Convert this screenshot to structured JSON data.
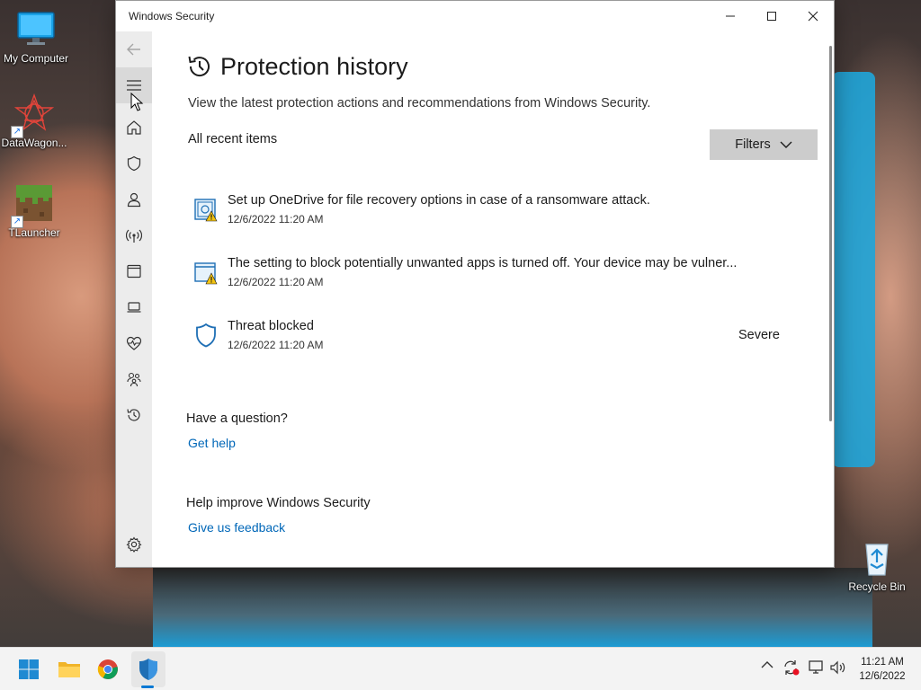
{
  "desktop": {
    "icons": [
      {
        "label": "My Computer"
      },
      {
        "label": "DataWagon..."
      },
      {
        "label": "TLauncher"
      },
      {
        "label": "Recycle Bin"
      }
    ]
  },
  "window": {
    "title": "Windows Security",
    "controls": {
      "minimize": "—",
      "maximize": "☐",
      "close": "✕"
    }
  },
  "sidebar": {
    "items": [
      {
        "name": "back-arrow-icon"
      },
      {
        "name": "hamburger-menu-icon"
      },
      {
        "name": "home-icon"
      },
      {
        "name": "shield-icon"
      },
      {
        "name": "person-icon"
      },
      {
        "name": "network-icon"
      },
      {
        "name": "app-browser-icon"
      },
      {
        "name": "device-laptop-icon"
      },
      {
        "name": "health-heart-icon"
      },
      {
        "name": "family-icon"
      },
      {
        "name": "history-icon"
      },
      {
        "name": "settings-gear-icon"
      }
    ]
  },
  "page": {
    "title": "Protection history",
    "subtitle": "View the latest protection actions and recommendations from Windows Security.",
    "section_label": "All recent items",
    "filters_label": "Filters"
  },
  "history": [
    {
      "message": "Set up OneDrive for file recovery options in case of a ransomware attack.",
      "date": "12/6/2022 11:20 AM",
      "severity": "",
      "icon": "folder-shield-warning-icon"
    },
    {
      "message": "The setting to block potentially unwanted apps is turned off. Your device may be vulner...",
      "date": "12/6/2022 11:20 AM",
      "severity": "",
      "icon": "app-browser-warning-icon"
    },
    {
      "message": "Threat blocked",
      "date": "12/6/2022 11:20 AM",
      "severity": "Severe",
      "icon": "shield-outline-icon"
    }
  ],
  "help": {
    "question_heading": "Have a question?",
    "get_help": "Get help",
    "improve_heading": "Help improve Windows Security",
    "feedback": "Give us feedback"
  },
  "taskbar": {
    "clock_time": "11:21 AM",
    "clock_date": "12/6/2022",
    "accent": "#0078d4"
  }
}
